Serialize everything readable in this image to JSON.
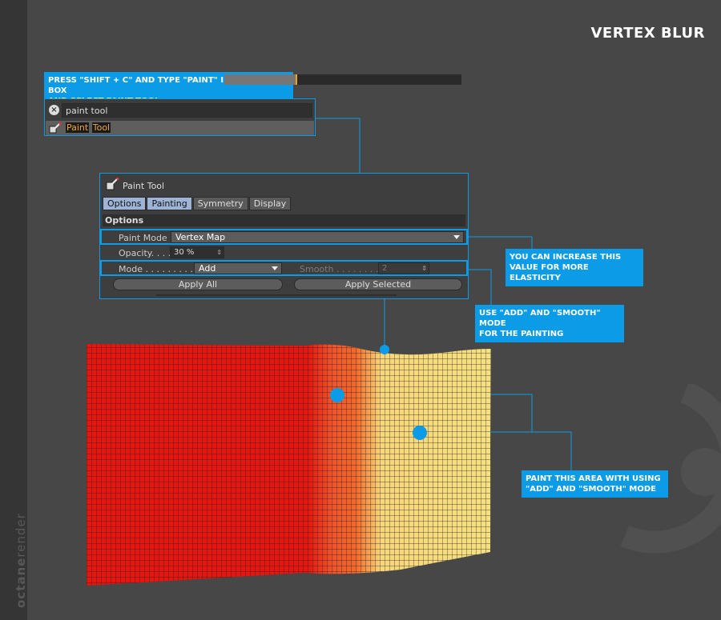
{
  "title": "VERTEX BLUR",
  "brand": {
    "bold": "octane",
    "light": "render"
  },
  "callouts": {
    "command": "PRESS \"SHIFT + C\" AND TYPE \"PAINT\" IN THE TYPE BOX\nAND SELECT PAINT TOOL",
    "elasticity": "YOU CAN INCREASE THIS\nVALUE FOR MORE ELASTICITY",
    "mode": "USE \"ADD\" AND \"SMOOTH\" MODE\nFOR THE PAINTING",
    "paint_area": "PAINT THIS AREA WITH USING\n\"ADD\" AND \"SMOOTH\" MODE"
  },
  "command_box": {
    "search_value": "paint tool",
    "result_part1": "Paint",
    "result_part2": "Tool"
  },
  "panel": {
    "title": "Paint Tool",
    "tabs": [
      {
        "label": "Options",
        "active": true
      },
      {
        "label": "Painting",
        "active": true
      },
      {
        "label": "Symmetry",
        "active": false
      },
      {
        "label": "Display",
        "active": false
      }
    ],
    "section": "Options",
    "paint_mode_label": "Paint Mode",
    "paint_mode_value": "Vertex Map",
    "opacity_label": "Opacity. . . .",
    "opacity_value": "30 %",
    "opacity_level": 0.3,
    "mode_label": "Mode . . . . . . . . . .",
    "mode_value": "Add",
    "smooth_label": "Smooth . . . . . . . .",
    "smooth_value": "2",
    "apply_all": "Apply All",
    "apply_selected": "Apply Selected"
  },
  "colors": {
    "accent": "#0c9be6",
    "mesh_red": "#e5160f",
    "mesh_orange": "#f26a2c",
    "mesh_yellow": "#f6dd76"
  }
}
